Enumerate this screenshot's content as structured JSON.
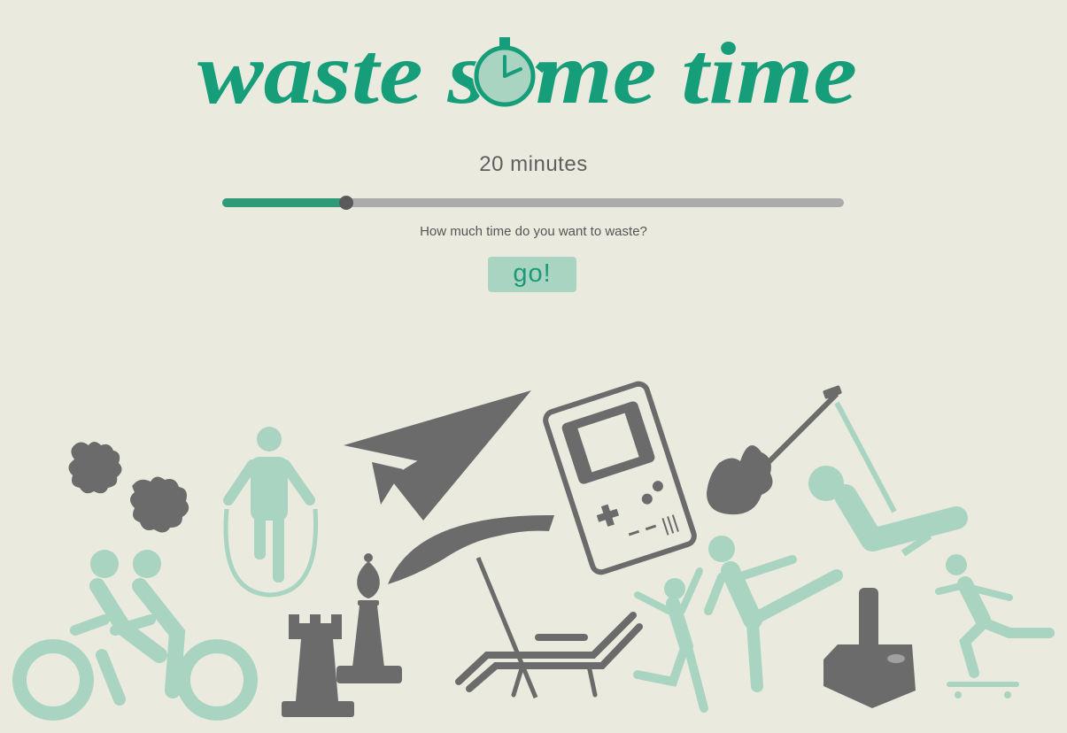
{
  "header": {
    "logo_text": "waste some time"
  },
  "timer": {
    "duration_label": "20 minutes",
    "minutes": 20,
    "slider_fraction": 0.2
  },
  "prompt": {
    "question": "How much time do you want to waste?"
  },
  "actions": {
    "go_label": "go!"
  },
  "colors": {
    "background": "#eaeadf",
    "accent": "#169d7a",
    "mint": "#a9d4c1",
    "gray": "#6b6b6b"
  },
  "icons": [
    "stopwatch-icon",
    "puzzle-icon",
    "jump-rope-icon",
    "paper-plane-icon",
    "handheld-console-icon",
    "electric-guitar-icon",
    "swing-icon",
    "tandem-bike-icon",
    "chess-rook-icon",
    "chess-bishop-icon",
    "beach-umbrella-icon",
    "lounge-chair-icon",
    "dancing-figures-icon",
    "martial-arts-icon",
    "joystick-icon",
    "skateboarder-icon"
  ]
}
